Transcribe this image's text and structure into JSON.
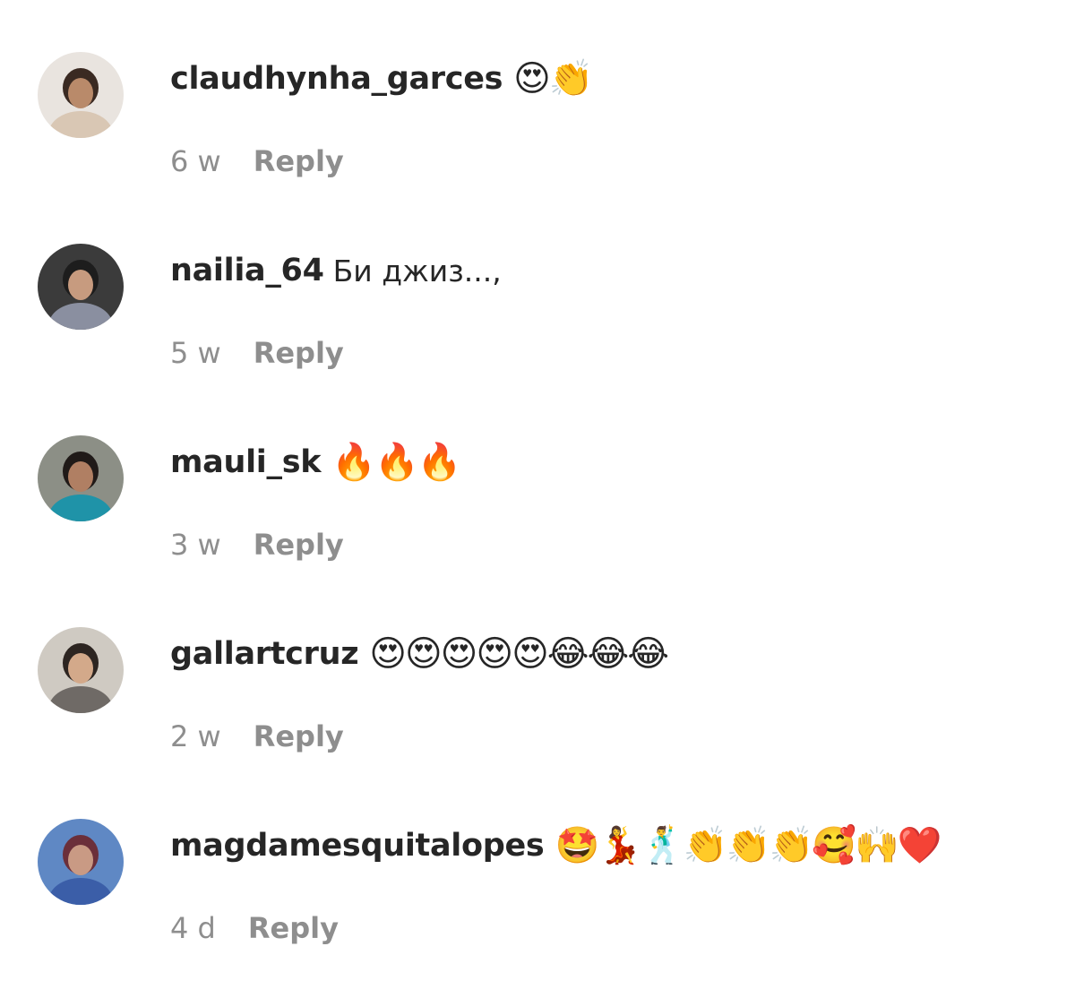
{
  "comments": [
    {
      "username": "claudhynha_garces",
      "text": "",
      "emojis": "😍👏",
      "time": "6 w",
      "reply": "Reply",
      "avatar": {
        "bg": "#e9e4df",
        "skin": "#b98a6a",
        "hair": "#3a2a22",
        "accent": "#d9c7b4"
      }
    },
    {
      "username": "nailia_64",
      "text": "Би джиз...,",
      "emojis": "",
      "time": "5 w",
      "reply": "Reply",
      "avatar": {
        "bg": "#3b3b3b",
        "skin": "#c79b7f",
        "hair": "#1d1d1d",
        "accent": "#8a8fa0"
      }
    },
    {
      "username": "mauli_sk",
      "text": "",
      "emojis": "🔥🔥🔥",
      "time": "3 w",
      "reply": "Reply",
      "avatar": {
        "bg": "#8c8f86",
        "skin": "#b07f63",
        "hair": "#201a18",
        "accent": "#1f93a8"
      }
    },
    {
      "username": "gallartcruz",
      "text": "",
      "emojis": "😍😍😍😍😍😂😂😂",
      "time": "2 w",
      "reply": "Reply",
      "avatar": {
        "bg": "#cfcac2",
        "skin": "#d3a98a",
        "hair": "#2d2521",
        "accent": "#6f6a66"
      }
    },
    {
      "username": "magdamesquitalopes",
      "text": "",
      "emojis": "🤩💃🕺👏👏👏🥰🙌❤️",
      "time": "4 d",
      "reply": "Reply",
      "avatar": {
        "bg": "#5f88c4",
        "skin": "#c99a84",
        "hair": "#6b2f3a",
        "accent": "#3b5ea8"
      }
    }
  ]
}
